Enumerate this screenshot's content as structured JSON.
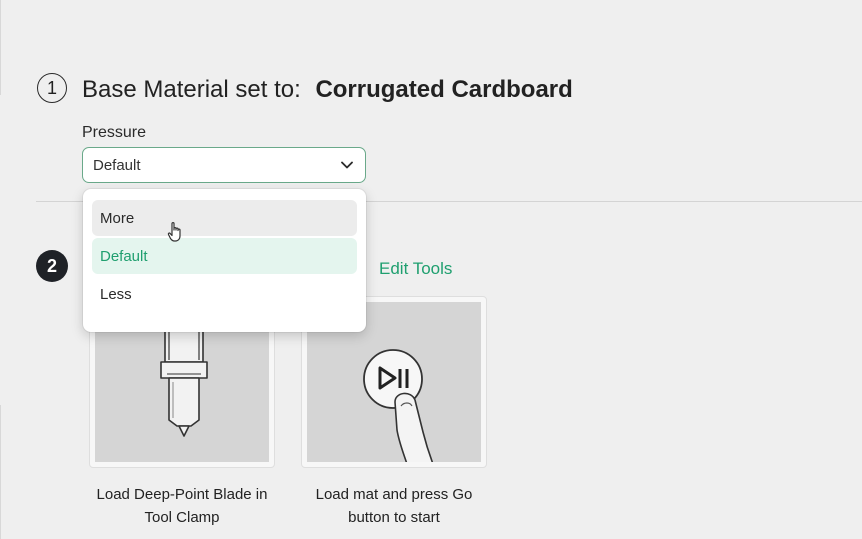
{
  "step1": {
    "number": "1",
    "title_prefix": "Base Material set to:",
    "material": "Corrugated Cardboard",
    "pressure_label": "Pressure",
    "pressure_value": "Default",
    "pressure_options": [
      "More",
      "Default",
      "Less"
    ],
    "hovered_option": "More",
    "selected_option": "Default"
  },
  "step2": {
    "number": "2",
    "edit_tools_label": "Edit Tools",
    "cards": [
      {
        "caption_line1": "Load Deep-Point Blade in",
        "caption_line2": "Tool Clamp",
        "icon": "blade-icon"
      },
      {
        "caption_line1": "Load mat and press Go",
        "caption_line2": "button to start",
        "icon": "go-button-icon"
      }
    ]
  },
  "colors": {
    "accent": "#1f9f6f",
    "select_border": "#6aa98a",
    "selected_bg": "#e4f5ee",
    "background": "#efefef"
  }
}
